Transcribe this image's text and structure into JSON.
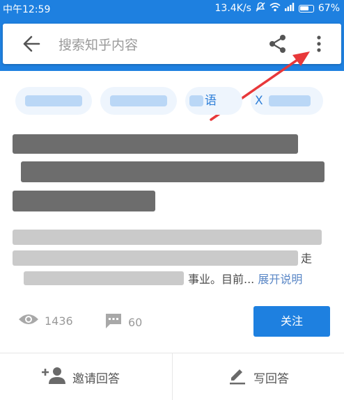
{
  "status_bar": {
    "time": "中午12:59",
    "network_speed": "13.4K/s",
    "battery": "67%"
  },
  "search": {
    "placeholder": "搜索知乎内容"
  },
  "icons": {
    "back": "back-arrow-icon",
    "share": "share-icon",
    "more": "more-vertical-icon",
    "annotation": "red-arrow-annotation"
  },
  "topics": [
    {
      "label": ""
    },
    {
      "label": ""
    },
    {
      "label": "语"
    },
    {
      "label": "X"
    }
  ],
  "description": {
    "tail": "事业。目前...",
    "expand": "展开说明",
    "right_fragment": "走"
  },
  "stats": {
    "views": "1436",
    "comments": "60"
  },
  "actions": {
    "follow": "关注",
    "invite": "邀请回答",
    "write": "写回答"
  },
  "colors": {
    "primary": "#1e80e0",
    "annotation": "#e8383a"
  }
}
